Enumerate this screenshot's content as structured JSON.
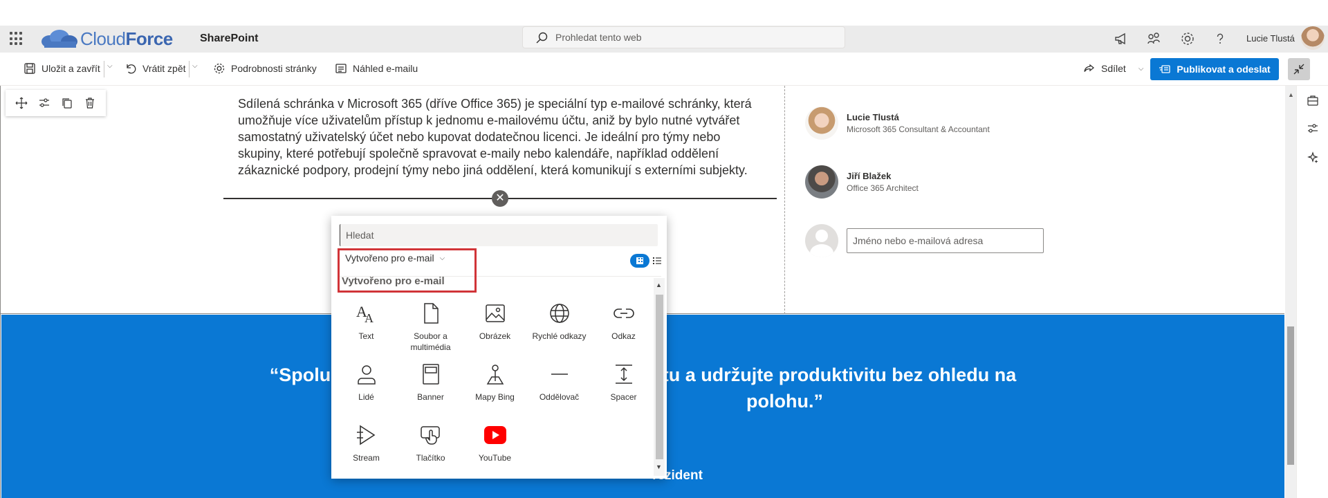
{
  "suite": {
    "brand_left": "Cloud",
    "brand_right": "Force",
    "app": "SharePoint",
    "search_placeholder": "Prohledat tento web",
    "user": "Lucie Tlustá"
  },
  "commands": {
    "save_close": "Uložit a zavřít",
    "undo": "Vrátit zpět",
    "page_details": "Podrobnosti stránky",
    "email_preview": "Náhled e-mailu",
    "share": "Sdílet",
    "publish": "Publikovat a odeslat"
  },
  "content": {
    "paragraph": "Sdílená schránka v Microsoft 365 (dříve Office 365) je speciální typ e-mailové schránky, která umožňuje více uživatelům přístup k jednomu e-mailovému účtu, aniž by bylo nutné vytvářet samostatný uživatelský účet nebo kupovat dodatečnou licenci. Je ideální pro týmy nebo skupiny, které potřebují společně spravovat e-maily nebo kalendáře, například oddělení zákaznické podpory, prodejní týmy nebo jiná oddělení, která komunikují s externími subjekty.",
    "close_symbol": "✕"
  },
  "people": [
    {
      "name": "Lucie Tlustá",
      "role": "Microsoft 365 Consultant & Accountant"
    },
    {
      "name": "Jiří Blažek",
      "role": "Office 365 Architect"
    }
  ],
  "people_input_placeholder": "Jméno nebo e-mailová adresa",
  "quote": {
    "line1_start": "“Spolupra",
    "line1_end": "vitu a udržujte produktivitu bez ohledu na",
    "line2_end": "polohu.”",
    "author_fragment": "rezident"
  },
  "toolbox": {
    "search_placeholder": "Hledat",
    "filter_label": "Vytvořeno pro e-mail",
    "section_heading": "Vytvořeno pro e-mail",
    "items": [
      {
        "label": "Text",
        "icon": "text-icon"
      },
      {
        "label": "Soubor a multimédia",
        "icon": "file-icon"
      },
      {
        "label": "Obrázek",
        "icon": "image-icon"
      },
      {
        "label": "Rychlé odkazy",
        "icon": "globe-icon"
      },
      {
        "label": "Odkaz",
        "icon": "link-icon"
      },
      {
        "label": "Lidé",
        "icon": "person-icon"
      },
      {
        "label": "Banner",
        "icon": "banner-icon"
      },
      {
        "label": "Mapy Bing",
        "icon": "map-pin-icon"
      },
      {
        "label": "Oddělovač",
        "icon": "divider-icon"
      },
      {
        "label": "Spacer",
        "icon": "spacer-icon"
      },
      {
        "label": "Stream",
        "icon": "stream-icon"
      },
      {
        "label": "Tlačítko",
        "icon": "button-icon"
      },
      {
        "label": "YouTube",
        "icon": "youtube-icon"
      }
    ]
  },
  "colors": {
    "accent": "#0a78d4",
    "highlight": "#d13438",
    "youtube": "#ff0000"
  }
}
